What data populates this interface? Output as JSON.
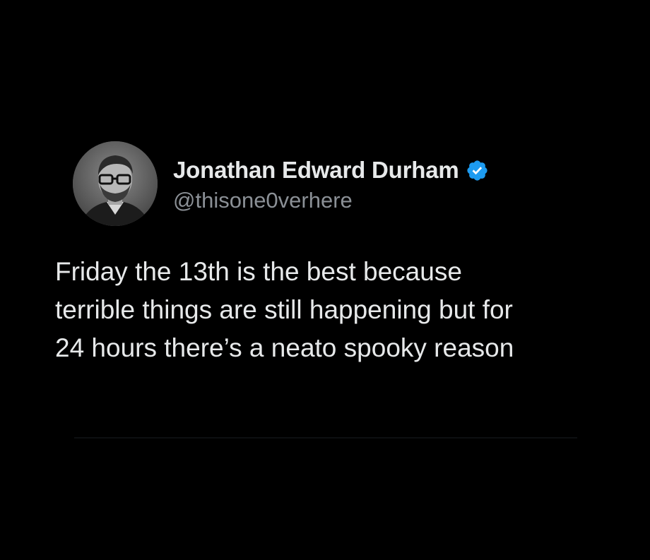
{
  "post": {
    "author": {
      "display_name": "Jonathan Edward Durham",
      "handle": "@thisone0verhere",
      "verified": true,
      "avatar_icon": "profile-photo-avatar"
    },
    "text": "Friday the 13th is the best because\nterrible things are still happening but for\n24 hours there’s a neato spooky reason"
  },
  "colors": {
    "background": "#000000",
    "primary_text": "#e7e9ea",
    "secondary_text": "#8b9096",
    "verified_badge": "#1d9bf0"
  },
  "icons": {
    "verified": "verified-badge-icon"
  }
}
